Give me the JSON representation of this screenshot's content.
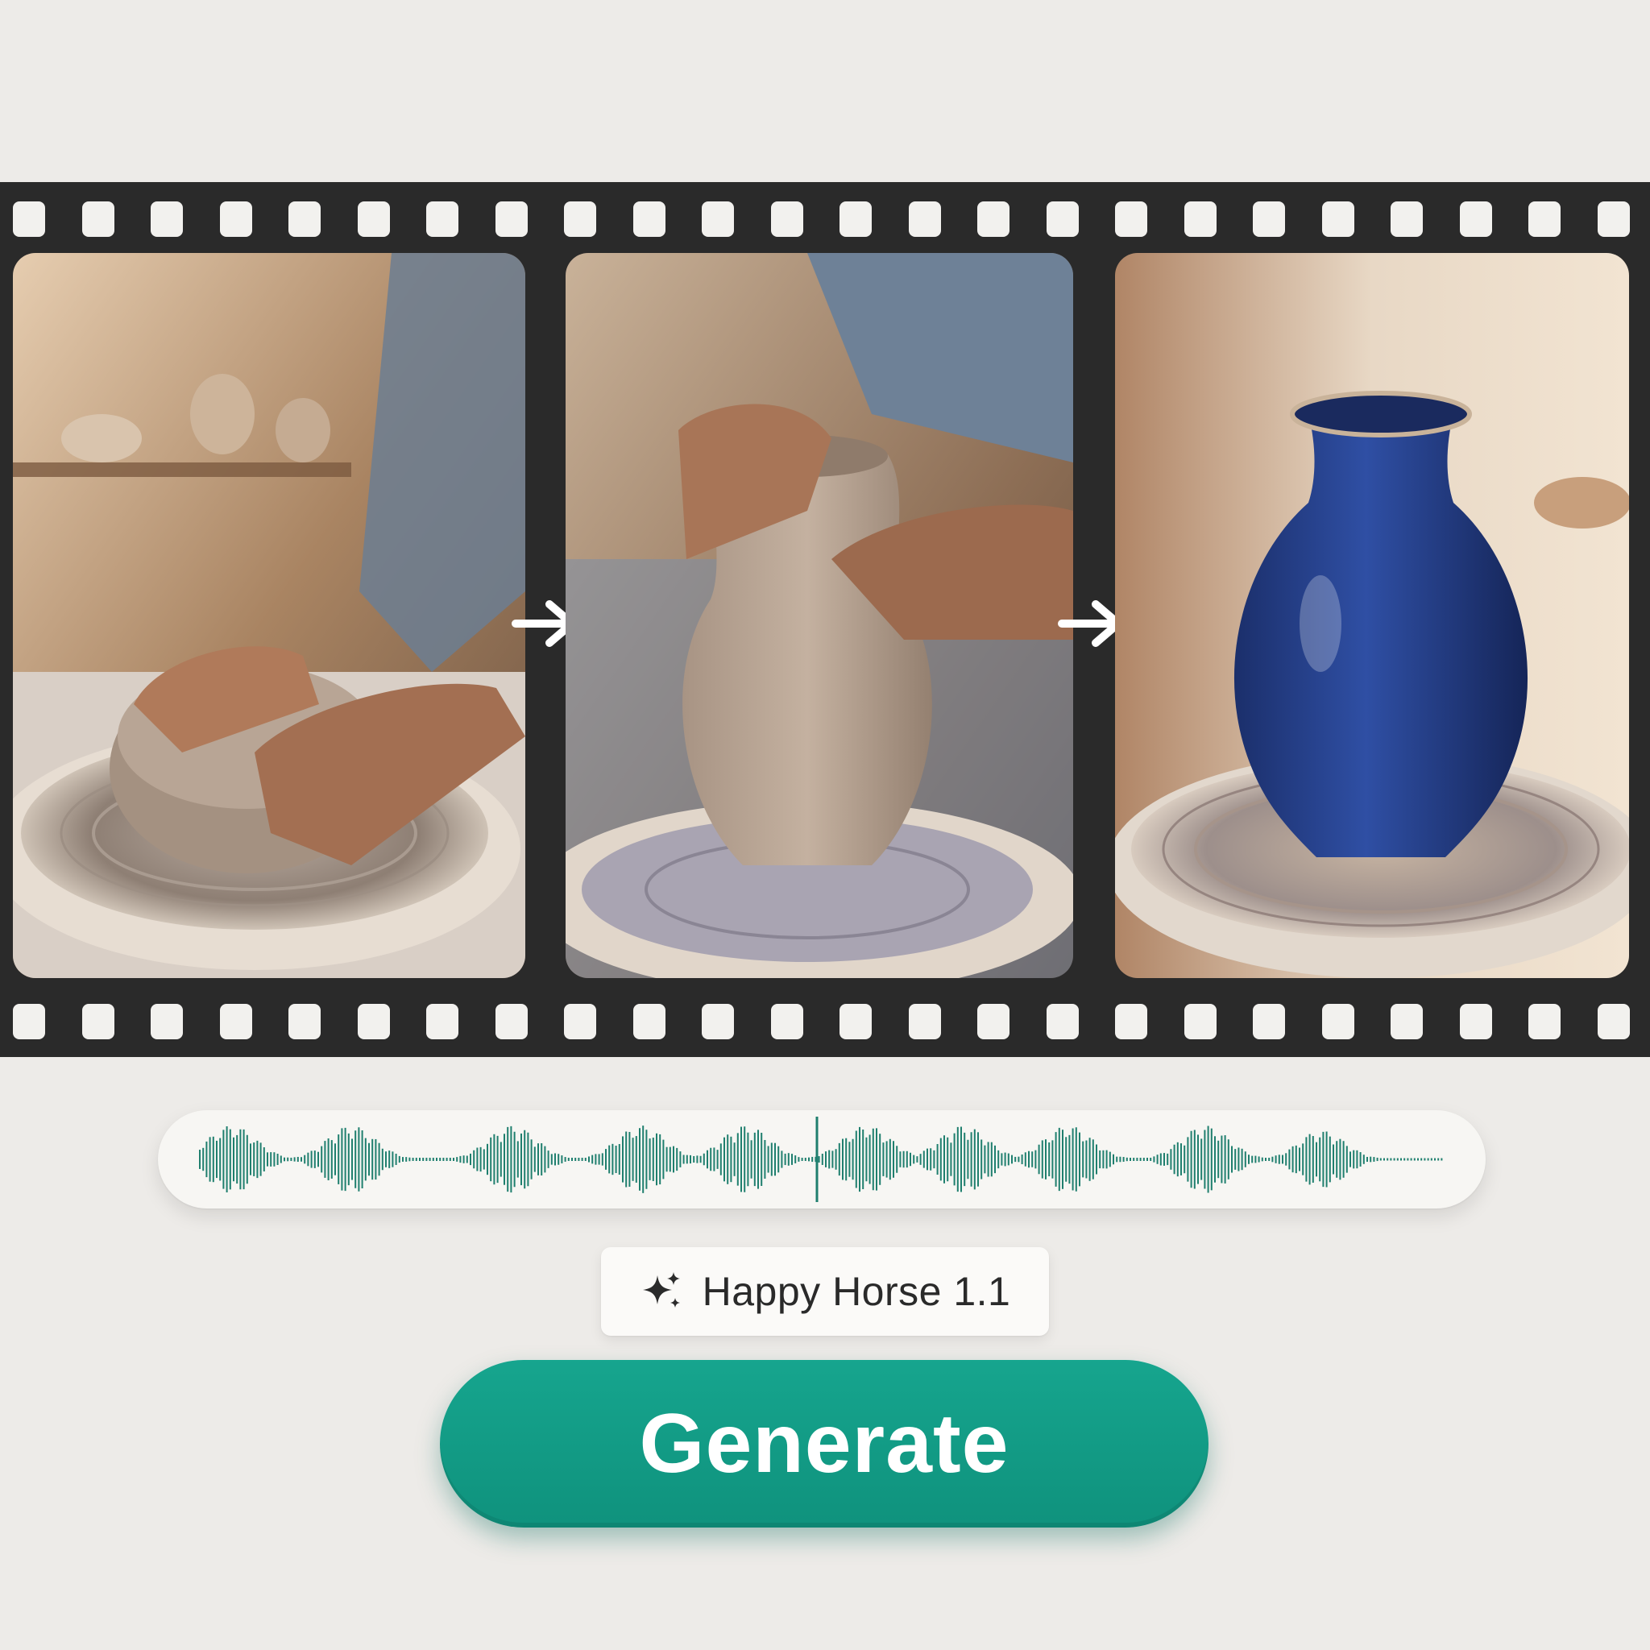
{
  "frames": [
    {
      "description_icon": "potter-centering-clay-image"
    },
    {
      "description_icon": "potter-shaping-vase-image"
    },
    {
      "description_icon": "glazed-blue-vase-image"
    }
  ],
  "arrows": [
    "arrow-right-icon",
    "arrow-right-icon"
  ],
  "model_selector": {
    "icon": "sparkle-icon",
    "label": "Happy Horse 1.1"
  },
  "generate_button": {
    "label": "Generate"
  },
  "colors": {
    "accent": "#12a08a",
    "waveform": "#1f7f6e",
    "film": "#2a2a2a",
    "background": "#edebe8"
  }
}
